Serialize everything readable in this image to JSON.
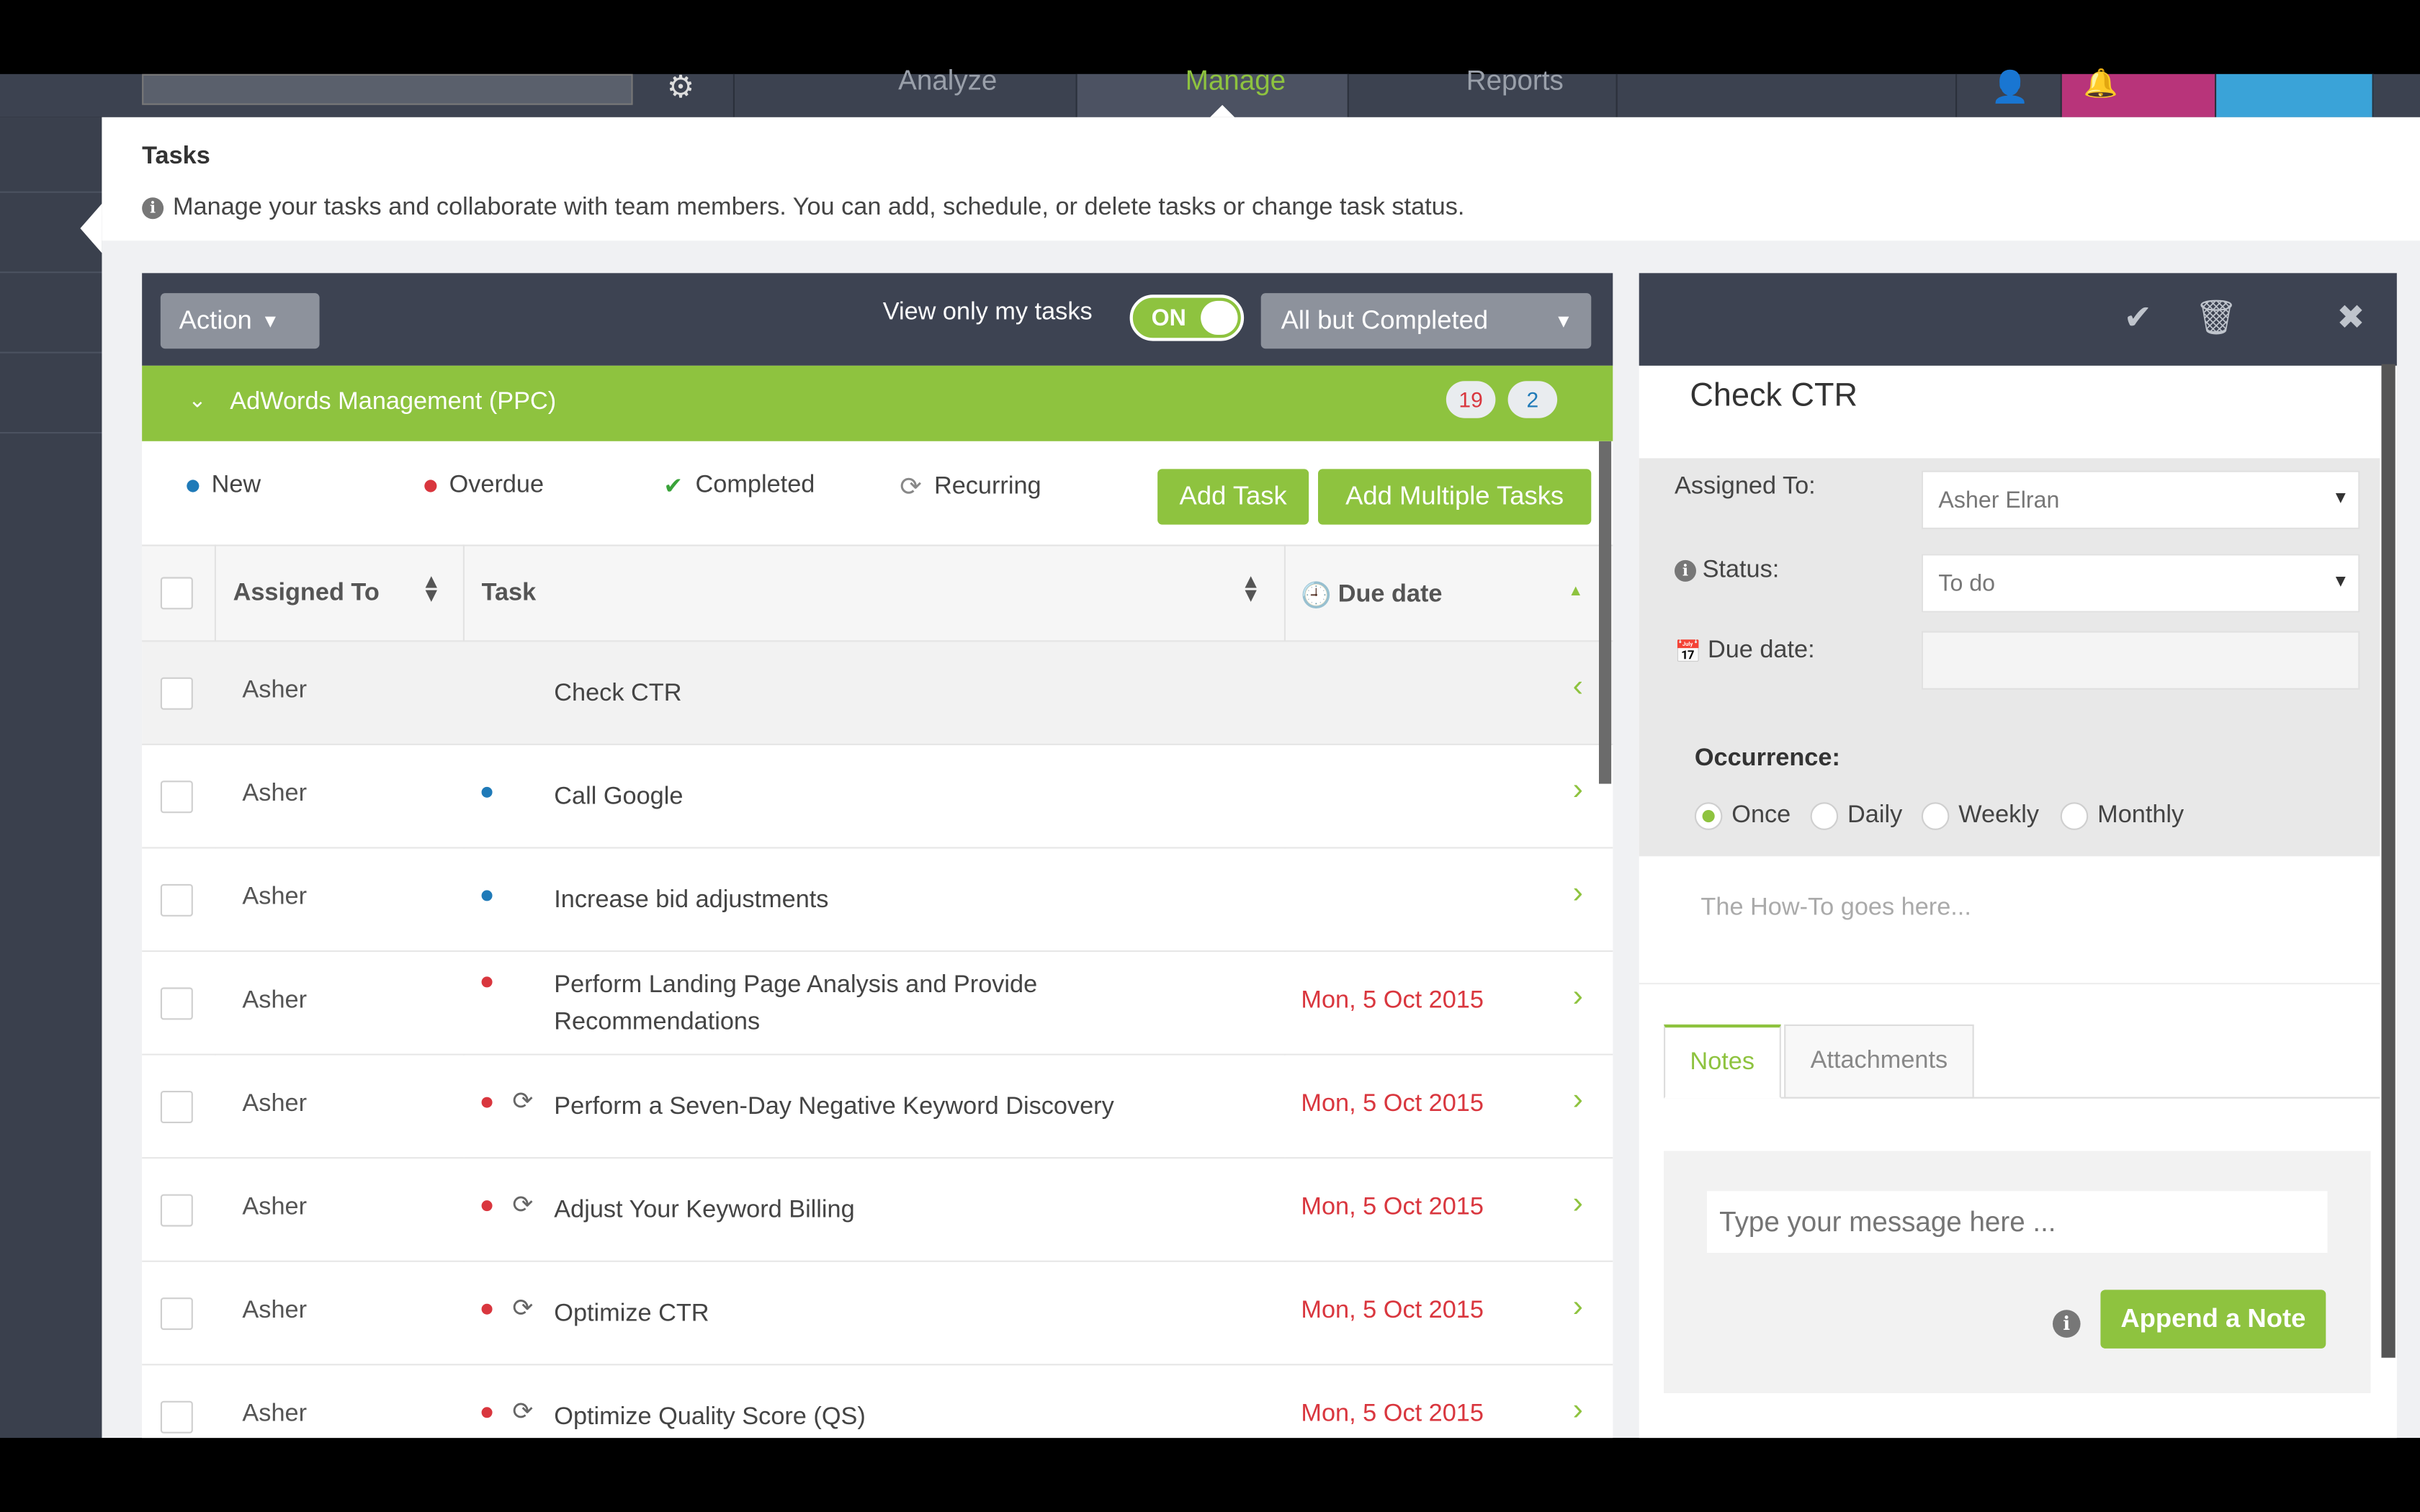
{
  "nav": {
    "analyze": "Analyze",
    "manage": "Manage",
    "reports": "Reports"
  },
  "page": {
    "title": "Tasks",
    "description": "Manage your tasks and collaborate with team members. You can add, schedule, or delete tasks or change task status."
  },
  "toolbar": {
    "action_label": "Action",
    "view_label": "View only my tasks",
    "toggle_label": "ON",
    "filter_label": "All but Completed"
  },
  "group": {
    "name": "AdWords Management (PPC)",
    "count_red": "19",
    "count_blue": "2"
  },
  "legend": {
    "new": "New",
    "overdue": "Overdue",
    "completed": "Completed",
    "recurring": "Recurring"
  },
  "buttons": {
    "add_task": "Add Task",
    "add_multiple": "Add Multiple Tasks"
  },
  "table": {
    "headers": {
      "assigned": "Assigned To",
      "task": "Task",
      "due": "Due date"
    },
    "rows": [
      {
        "assigned": "Asher",
        "task": "Check CTR",
        "due": "",
        "status": "selected"
      },
      {
        "assigned": "Asher",
        "task": "Call Google",
        "due": "",
        "status": "new"
      },
      {
        "assigned": "Asher",
        "task": "Increase bid adjustments",
        "due": "",
        "status": "new"
      },
      {
        "assigned": "Asher",
        "task": "Perform Landing Page Analysis and Provide Recommendations",
        "due": "Mon, 5 Oct 2015",
        "status": "overdue"
      },
      {
        "assigned": "Asher",
        "task": "Perform a Seven-Day Negative Keyword Discovery",
        "due": "Mon, 5 Oct 2015",
        "status": "overdue-recurring"
      },
      {
        "assigned": "Asher",
        "task": "Adjust Your Keyword Billing",
        "due": "Mon, 5 Oct 2015",
        "status": "overdue-recurring"
      },
      {
        "assigned": "Asher",
        "task": "Optimize CTR",
        "due": "Mon, 5 Oct 2015",
        "status": "overdue-recurring"
      },
      {
        "assigned": "Asher",
        "task": "Optimize Quality Score (QS)",
        "due": "Mon, 5 Oct 2015",
        "status": "overdue-recurring"
      }
    ]
  },
  "detail": {
    "title": "Check CTR",
    "assigned_label": "Assigned To:",
    "assigned_value": "Asher Elran",
    "status_label": "Status:",
    "status_value": "To do",
    "due_label": "Due date:",
    "occurrence_label": "Occurrence:",
    "occurrences": [
      "Once",
      "Daily",
      "Weekly",
      "Monthly"
    ],
    "howto_placeholder": "The How-To goes here...",
    "tab_notes": "Notes",
    "tab_attachments": "Attachments",
    "message_placeholder": "Type your message here ...",
    "append_label": "Append a Note"
  },
  "colors": {
    "accent": "#8ec33f",
    "dark": "#3d4352",
    "overdue": "#d9363e",
    "new": "#1f7ab8"
  }
}
